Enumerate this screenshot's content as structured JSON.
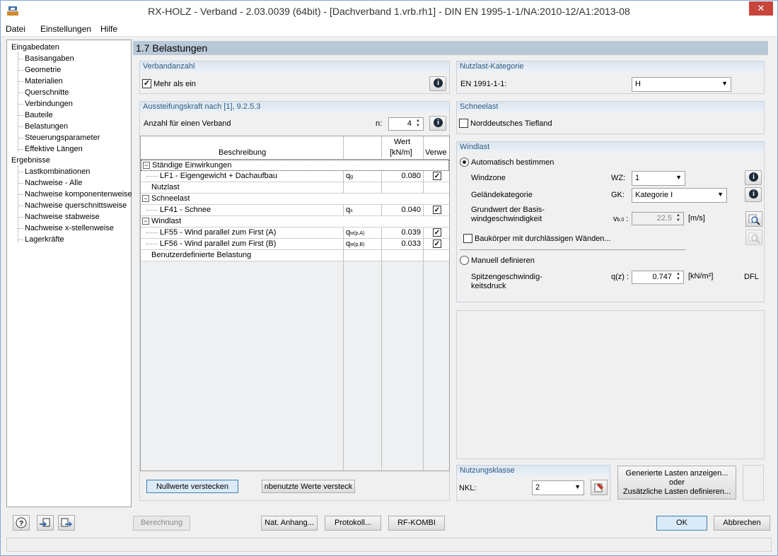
{
  "window": {
    "title": "RX-HOLZ - Verband - 2.03.0039 (64bit) - [Dachverband 1.vrb.rh1] - DIN EN 1995-1-1/NA:2010-12/A1:2013-08",
    "close": "✕"
  },
  "menu": [
    "Datei",
    "Einstellungen",
    "Hilfe"
  ],
  "tree": {
    "input_root": "Eingabedaten",
    "input_items": [
      "Basisangaben",
      "Geometrie",
      "Materialien",
      "Querschnitte",
      "Verbindungen",
      "Bauteile",
      "Belastungen",
      "Steuerungsparameter",
      "Effektive Längen"
    ],
    "results_root": "Ergebnisse",
    "results_items": [
      "Lastkombinationen",
      "Nachweise - Alle",
      "Nachweise komponentenweise",
      "Nachweise querschnittsweise",
      "Nachweise stabweise",
      "Nachweise x-stellenweise",
      "Lagerkräfte"
    ]
  },
  "page_title": "1.7 Belastungen",
  "verbandanzahl": {
    "title": "Verbandanzahl",
    "checkbox_label": "Mehr als ein",
    "checked": true
  },
  "aussteifung": {
    "title": "Aussteifungskraft nach [1], 9.2.5.3",
    "anzahl_label": "Anzahl für einen Verband",
    "n_label": "n:",
    "n_value": "4",
    "headers": {
      "beschreibung": "Beschreibung",
      "wert": "Wert",
      "unit": "[kN/m]",
      "verwe": "Verwe"
    },
    "rows": [
      {
        "kind": "group",
        "toggle": "−",
        "label": "Ständige Einwirkungen"
      },
      {
        "kind": "item",
        "label": "LF1 - Eigengewicht + Dachaufbau",
        "sym": "q",
        "sub": "g",
        "value": "0.080",
        "checked": true
      },
      {
        "kind": "plain",
        "label": "Nutzlast"
      },
      {
        "kind": "group",
        "toggle": "−",
        "label": "Schneelast"
      },
      {
        "kind": "item",
        "label": "LF41 - Schnee",
        "sym": "q",
        "sub": "s",
        "value": "0.040",
        "checked": true
      },
      {
        "kind": "group",
        "toggle": "−",
        "label": "Windlast"
      },
      {
        "kind": "item",
        "label": "LF55 - Wind parallel zum First (A)",
        "sym": "q",
        "sub": "w(p,A)",
        "value": "0.039",
        "checked": true
      },
      {
        "kind": "item",
        "label": "LF56 - Wind parallel zum First (B)",
        "sym": "q",
        "sub": "w(p,B)",
        "value": "0.033",
        "checked": true
      },
      {
        "kind": "plain",
        "label": "Benutzerdefinierte Belastung"
      }
    ],
    "btn_null": "Nullwerte verstecken",
    "btn_unused": "nbenutzte Werte versteck"
  },
  "nutzlast": {
    "title": "Nutzlast-Kategorie",
    "label": "EN 1991-1-1:",
    "value": "H"
  },
  "schneelast": {
    "title": "Schneelast",
    "checkbox_label": "Norddeutsches Tiefland",
    "checked": false
  },
  "windlast": {
    "title": "Windlast",
    "auto_label": "Automatisch bestimmen",
    "windzone_label": "Windzone",
    "wz_label": "WZ:",
    "wz_value": "1",
    "gelaende_label": "Geländekategorie",
    "gk_label": "GK:",
    "gk_value": "Kategorie I",
    "grund_label1": "Grundwert der Basis-",
    "grund_label2": "windgeschwindigkeit",
    "vb_sym": "v",
    "vb_sub": "b,0",
    "vb_value": "22.5",
    "vb_unit": "[m/s]",
    "durchl_label": "Baukörper mit durchlässigen Wänden...",
    "durchl_checked": false,
    "manual_label": "Manuell definieren",
    "spitz_label1": "Spitzengeschwindig-",
    "spitz_label2": "keitsdruck",
    "qz_label": "q(z) :",
    "qz_value": "0.747",
    "qz_unit": "[kN/m²]",
    "dfl": "DFL"
  },
  "nutzungsklasse": {
    "title": "Nutzungsklasse",
    "label": "NKL:",
    "value": "2"
  },
  "btn_generiert": {
    "line1": "Generierte Lasten anzeigen...",
    "line2": "oder",
    "line3": "Zusätzliche Lasten definieren..."
  },
  "footer": {
    "berechnung": "Berechnung",
    "nat": "Nat. Anhang...",
    "protokoll": "Protokoll...",
    "rfkombi": "RF-KOMBI",
    "ok": "OK",
    "abbrechen": "Abbrechen"
  }
}
